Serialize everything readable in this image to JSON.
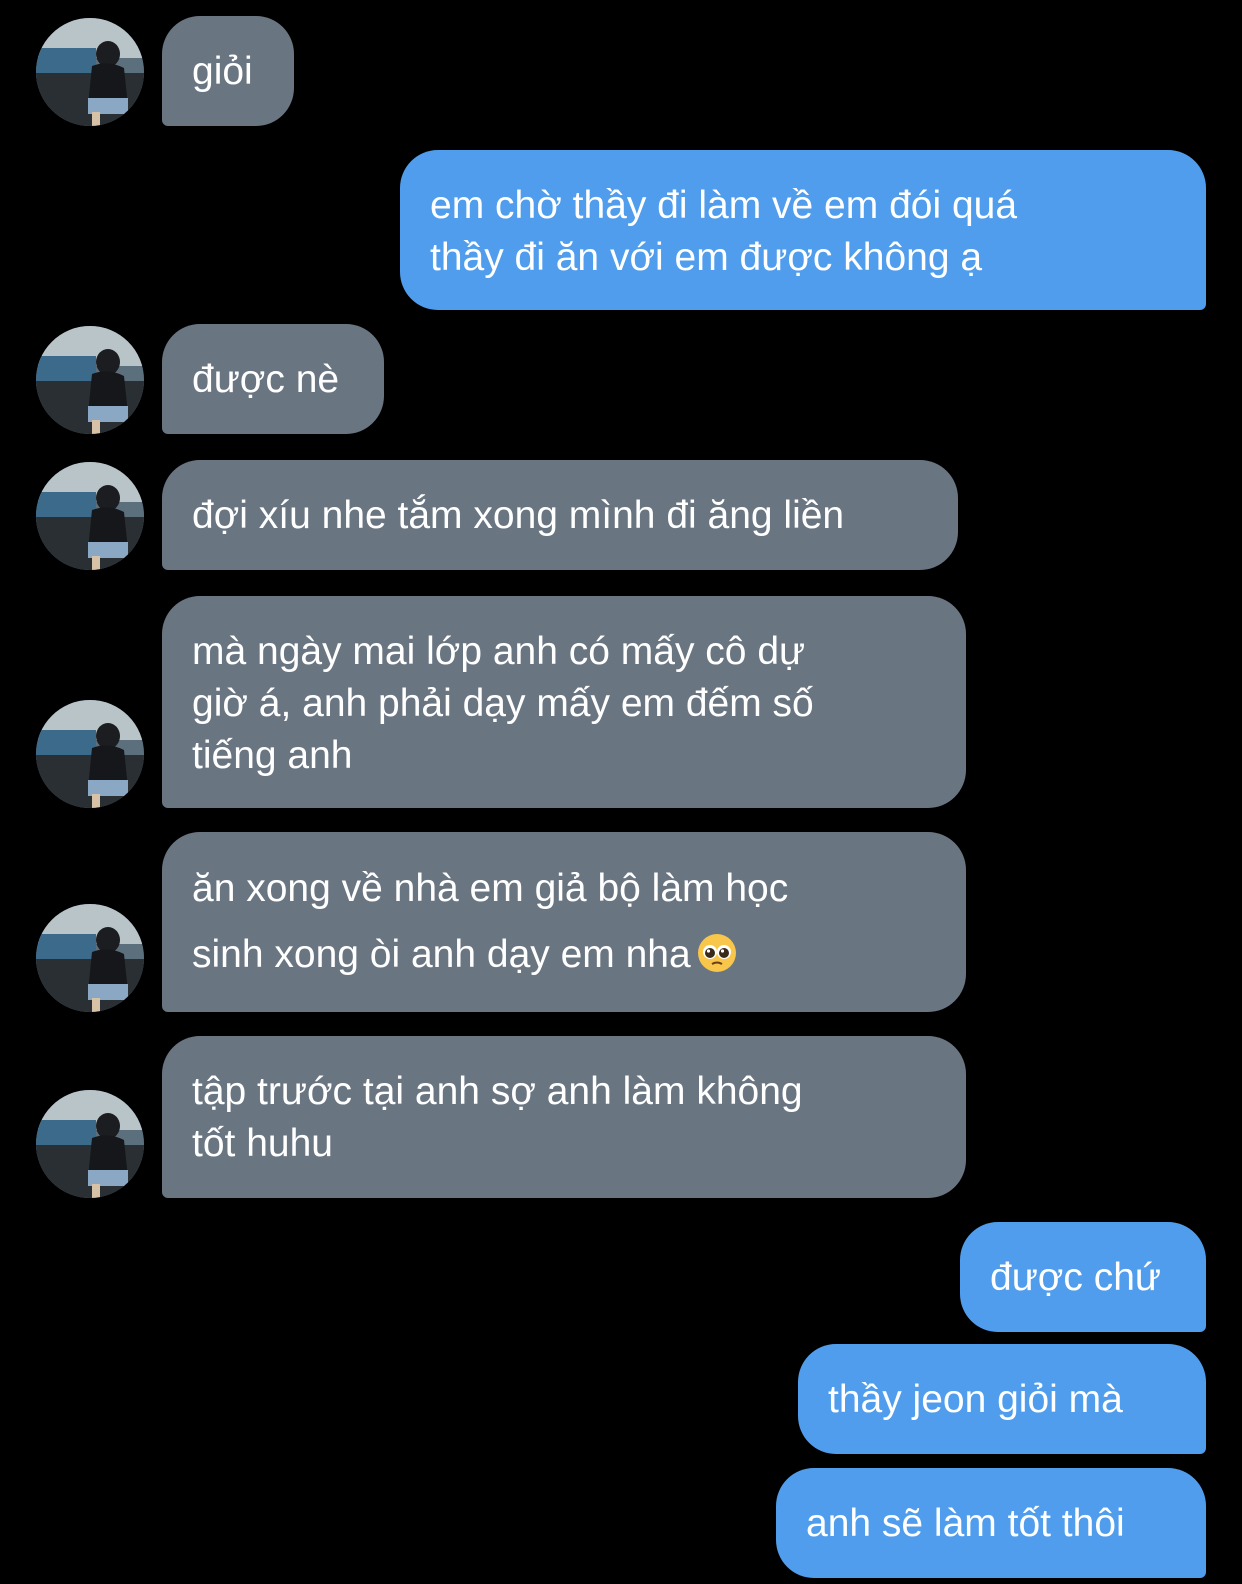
{
  "colors": {
    "background": "#000000",
    "incoming_bubble": "#6a7582",
    "outgoing_bubble": "#4f9dec",
    "text": "#ffffff"
  },
  "messages": [
    {
      "side": "incoming",
      "text": "giỏi"
    },
    {
      "side": "outgoing",
      "text": "em chờ thầy đi làm về em đói quá\nthầy đi ăn với em được không ạ"
    },
    {
      "side": "incoming",
      "text": "được nè"
    },
    {
      "side": "incoming",
      "text": "đợi xíu nhe tắm xong mình đi ăng liền"
    },
    {
      "side": "incoming",
      "text": "mà ngày mai lớp anh có mấy cô dự\ngiờ á, anh phải dạy mấy em đếm số\ntiếng anh"
    },
    {
      "side": "incoming",
      "text": "ăn xong về nhà em giả bộ làm học\nsinh xong òi anh dạy em nha",
      "emoji": "pleading-face"
    },
    {
      "side": "incoming",
      "text": "tập trước tại anh sợ anh làm không\ntốt huhu"
    },
    {
      "side": "outgoing",
      "text": "được chứ"
    },
    {
      "side": "outgoing",
      "text": "thầy jeon giỏi mà"
    },
    {
      "side": "outgoing",
      "text": "anh sẽ làm tốt thôi"
    }
  ]
}
